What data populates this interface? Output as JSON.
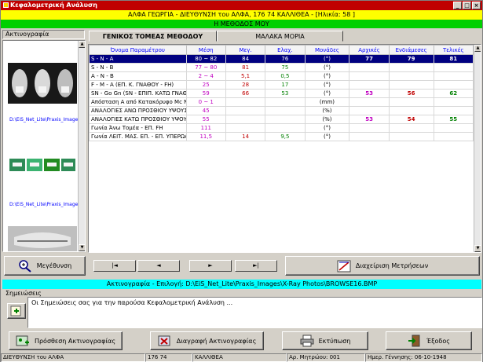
{
  "window": {
    "title": "Κεφαλομετρική Ανάλυση"
  },
  "patient_bar": "ΑΛΦΑ ΓΕΩΡΓΙΑ - ΔΙΕΥΘΥΝΣΗ του ΑΛΦΑ, 176 74 ΚΑΛΛΙΘΕΑ - [Ηλικία: 58 ]",
  "method_bar": "Η ΜΕΘΟΔΟΣ ΜΟΥ",
  "xrays": {
    "label": "Ακτινογραφία",
    "items": [
      {
        "path": "D:\\EiS_Net_Lite\\Praxis_Images"
      },
      {
        "path": "D:\\EiS_Net_Lite\\Praxis_Images"
      }
    ]
  },
  "tabs": [
    {
      "label": "ΓΕΝΙΚΟΣ ΤΟΜΕΑΣ ΜΕΘΟΔΟΥ"
    },
    {
      "label": "ΜΑΛΑΚΑ ΜΟΡΙΑ"
    }
  ],
  "table": {
    "headers": [
      "Όνομα Παραμέτρου",
      "Μέση",
      "Μεγ.",
      "Ελαχ.",
      "Μονάδες",
      "Αρχικές",
      "Ενδιάμεσες",
      "Τελικές"
    ],
    "rows": [
      [
        "S - N - A",
        "80 ~ 82",
        "84",
        "76",
        "(°)",
        "77",
        "79",
        "81"
      ],
      [
        "S - N - B",
        "77 ~ 80",
        "81",
        "75",
        "(°)",
        "",
        "",
        ""
      ],
      [
        "A - N - B",
        "2 ~ 4",
        "5,1",
        "0,5",
        "(°)",
        "",
        "",
        ""
      ],
      [
        "F - M - A  (ΕΠ. Κ. ΓΝΑΘΟΥ - FH)",
        "25",
        "28",
        "17",
        "(°)",
        "",
        "",
        ""
      ],
      [
        "SN - Go Gn (SN - ΕΠΙΠ. ΚΑΤΩ ΓΝΑΘΟΥ)",
        "59",
        "66",
        "53",
        "(°)",
        "53",
        "56",
        "62"
      ],
      [
        "Απόσταση A από Κατακόρυφο Mc Nama",
        "0 ~ 1",
        "",
        "",
        "(mm)",
        "",
        "",
        ""
      ],
      [
        "ΑΝΑΛΟΓΙΕΣ ΑΝΩ ΠΡΟΣΘΙΟΥ ΥΨΟΥΣ =",
        "45",
        "",
        "",
        "(%)",
        "",
        "",
        ""
      ],
      [
        "ΑΝΑΛΟΓΙΕΣ ΚΑΤΩ ΠΡΟΣΘΙΟΥ ΥΨΟΥΣ",
        "55",
        "",
        "",
        "(%)",
        "53",
        "54",
        "55"
      ],
      [
        "Γωνία Άνω Τομέα - ΕΠ. FH",
        "111",
        "",
        "",
        "(°)",
        "",
        "",
        ""
      ],
      [
        "Γωνία ΛΕΙΤ. ΜΑΣ. ΕΠ. - ΕΠ. ΥΠΕΡΩΑΣ",
        "11,5",
        "14",
        "9,5",
        "(°)",
        "",
        "",
        ""
      ]
    ]
  },
  "buttons": {
    "zoom": "Μεγέθυνση",
    "manage": "Διαχείριση Μετρήσεων",
    "add_xray": "Πρόσθεση Ακτινογραφίας",
    "delete_xray": "Διαγραφή Ακτινογραφίας",
    "print": "Εκτύπωση",
    "exit": "Έξοδος"
  },
  "nav": {
    "first": "|◄",
    "prev": "◄",
    "next": "►",
    "last": "►|"
  },
  "selected_path": "Ακτινογραφία - Επιλογή: D:\\EiS_Net_Lite\\Praxis_Images\\X-Ray Photos\\BROWSE16.BMP",
  "notes": {
    "label": "Σημειώσεις",
    "text": "Οι Σημειώσεις σας για την παρούσα Κεφαλομετρική Ανάλυση ..."
  },
  "status": [
    "ΔΙΕΥΘΥΝΣΗ του ΑΛΦΑ",
    "176 74",
    "ΚΑΛΛΙΘΕΑ",
    "Αρ. Μητρώου: 001",
    "Ημερ. Γέννησης: 06-10-1948"
  ]
}
